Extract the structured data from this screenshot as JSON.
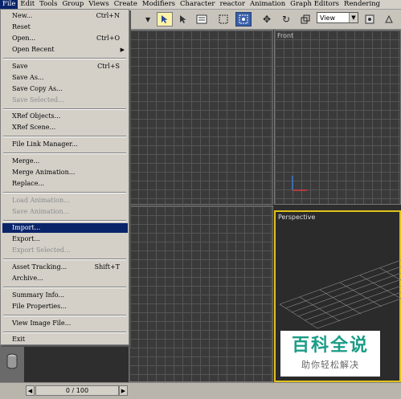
{
  "menubar": {
    "items": [
      "File",
      "Edit",
      "Tools",
      "Group",
      "Views",
      "Create",
      "Modifiers",
      "Character",
      "reactor",
      "Animation",
      "Graph Editors",
      "Rendering"
    ]
  },
  "toolbar": {
    "view_select": "View"
  },
  "viewports": {
    "front_label": "Front",
    "perspective_label": "Perspective"
  },
  "file_menu": {
    "new": "New...",
    "new_sc": "Ctrl+N",
    "reset": "Reset",
    "open": "Open...",
    "open_sc": "Ctrl+O",
    "open_recent": "Open Recent",
    "save": "Save",
    "save_sc": "Ctrl+S",
    "save_as": "Save As...",
    "save_copy_as": "Save Copy As...",
    "save_selected": "Save Selected...",
    "xref_objects": "XRef Objects...",
    "xref_scene": "XRef Scene...",
    "file_link_manager": "File Link Manager...",
    "merge": "Merge...",
    "merge_animation": "Merge Animation...",
    "replace": "Replace...",
    "load_animation": "Load Animation...",
    "save_animation": "Save Animation...",
    "import": "Import...",
    "export": "Export...",
    "export_selected": "Export Selected...",
    "asset_tracking": "Asset Tracking...",
    "asset_tracking_sc": "Shift+T",
    "archive": "Archive...",
    "summary_info": "Summary Info...",
    "file_properties": "File Properties...",
    "view_image_file": "View Image File...",
    "exit": "Exit"
  },
  "timeline": {
    "frame": "0 / 100"
  },
  "watermark": {
    "title": "百科全说",
    "subtitle": "助你轻松解决"
  }
}
